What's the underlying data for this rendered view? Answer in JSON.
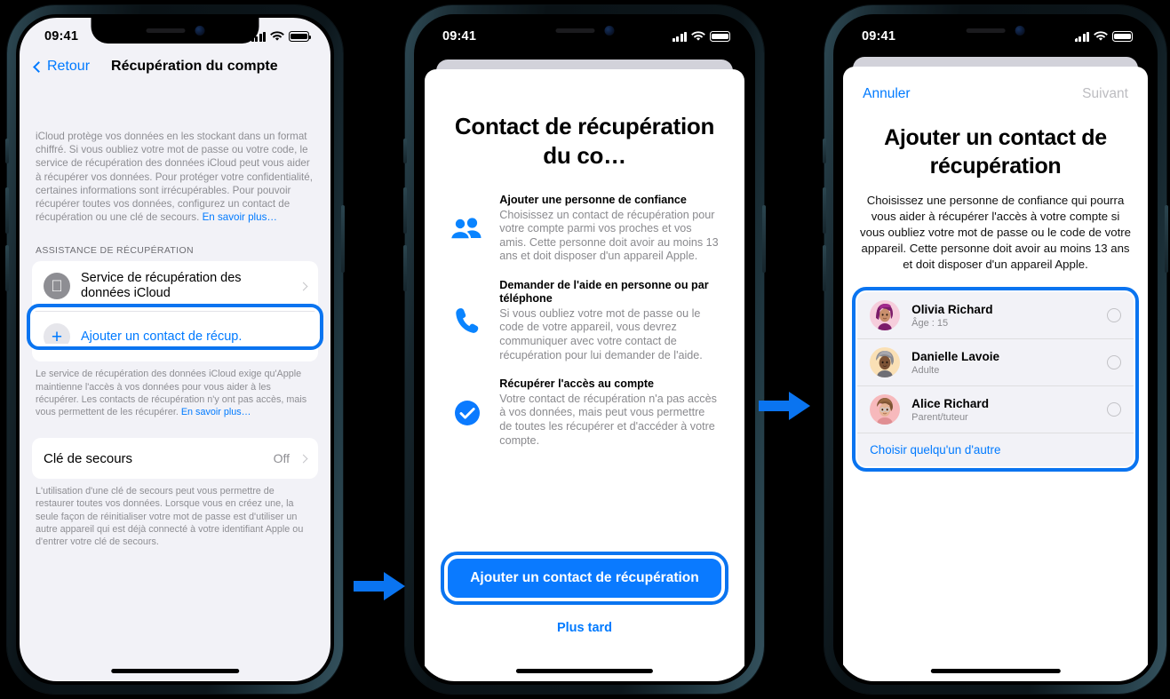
{
  "status_bar": {
    "time": "09:41",
    "signal_icon": "cellular-bars-icon",
    "wifi_icon": "wifi-icon",
    "battery_icon": "battery-icon"
  },
  "colors": {
    "accent_blue": "#007aff",
    "highlight_blue": "#0a74f0",
    "cta_blue": "#0a7aff",
    "muted_gray": "#8e8e93",
    "screen_bg": "#f2f2f7"
  },
  "phone1": {
    "nav": {
      "back_label": "Retour",
      "title": "Récupération du compte"
    },
    "intro": "iCloud protège vos données en les stockant dans un format chiffré. Si vous oubliez votre mot de passe ou votre code, le service de récupération des données iCloud peut vous aider à récupérer vos données. Pour protéger votre confidentialité, certaines informations sont irrécupérables. Pour pouvoir récupérer toutes vos données, configurez un contact de récupération ou une clé de secours. ",
    "intro_link": "En savoir plus…",
    "section_header": "ASSISTANCE DE RÉCUPÉRATION",
    "rows": [
      {
        "icon": "apple-logo-icon",
        "label": "Service de récupération des données iCloud",
        "accessory": "chevron-right-icon"
      },
      {
        "icon": "plus-icon",
        "label": "Ajouter un contact de récup.",
        "accessory": ""
      }
    ],
    "footer1": "Le service de récupération des données iCloud exige qu'Apple maintienne l'accès à vos données pour vous aider à les récupérer. Les contacts de récupération n'y ont pas accès, mais vous permettent de les récupérer. ",
    "footer1_link": "En savoir plus…",
    "recovery_key": {
      "label": "Clé de secours",
      "value": "Off"
    },
    "footer2": "L'utilisation d'une clé de secours peut vous permettre de restaurer toutes vos données. Lorsque vous en créez une, la seule façon de réinitialiser votre mot de passe est d'utiliser un autre appareil qui est déjà connecté à votre identifiant Apple ou d'entrer votre clé de secours."
  },
  "phone2": {
    "title": "Contact de récupération du co…",
    "features": [
      {
        "icon": "two-people-icon",
        "heading": "Ajouter une personne de confiance",
        "body": "Choisissez un contact de récupération pour votre compte parmi vos proches et vos amis. Cette personne doit avoir au moins 13 ans et doit disposer d'un appareil Apple."
      },
      {
        "icon": "phone-handset-icon",
        "heading": "Demander de l'aide en personne ou par téléphone",
        "body": "Si vous oubliez votre mot de passe ou le code de votre appareil, vous devrez communiquer avec votre contact de récupération pour lui demander de l'aide."
      },
      {
        "icon": "checkmark-circle-icon",
        "heading": "Récupérer l'accès au compte",
        "body": "Votre contact de récupération n'a pas accès à vos données, mais peut vous permettre de toutes les récupérer et d'accéder à votre compte."
      }
    ],
    "primary_button": "Ajouter un contact de récupération",
    "secondary_button": "Plus tard"
  },
  "phone3": {
    "cancel_label": "Annuler",
    "next_label": "Suivant",
    "title": "Ajouter un contact de récupération",
    "description": "Choisissez une personne de confiance qui pourra vous aider à récupérer l'accès à votre compte si vous oubliez votre mot de passe ou le code de votre appareil. Cette personne doit avoir au moins 13 ans et doit disposer d'un appareil Apple.",
    "contacts": [
      {
        "name": "Olivia Richard",
        "meta": "Âge : 15",
        "avatar": "memoji-avatar-pink",
        "bg": "#f6cddc",
        "hair": "#7c1c6a",
        "skin": "#c98f6c"
      },
      {
        "name": "Danielle Lavoie",
        "meta": "Adulte",
        "avatar": "memoji-avatar-cream",
        "bg": "#fae0b5",
        "hair": "#7d7d85",
        "skin": "#7d5336"
      },
      {
        "name": "Alice Richard",
        "meta": "Parent/tuteur",
        "avatar": "memoji-avatar-rose",
        "bg": "#f7b9bc",
        "hair": "#7d5333",
        "skin": "#e5b394"
      }
    ],
    "choose_other": "Choisir quelqu'un d'autre"
  },
  "arrows": [
    {
      "name": "flow-arrow-1",
      "label": "right-arrow-icon"
    },
    {
      "name": "flow-arrow-2",
      "label": "right-arrow-icon"
    }
  ]
}
